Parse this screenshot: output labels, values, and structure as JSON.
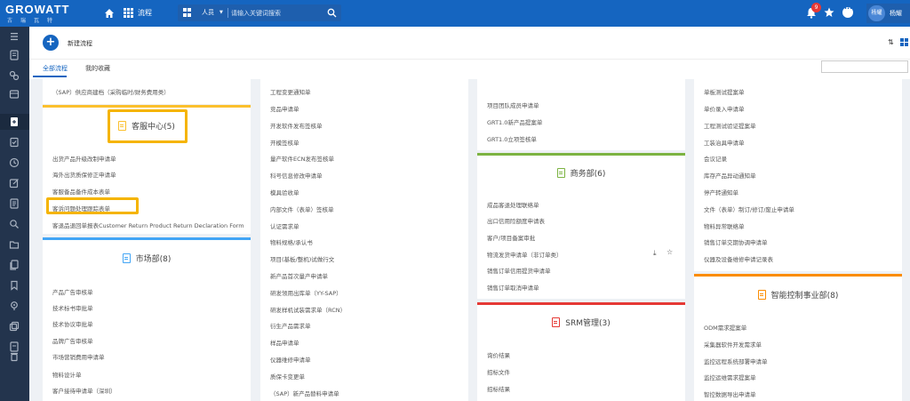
{
  "topbar": {
    "brand": "GROWATT",
    "brand_cn": "古瑞瓦特",
    "nav_label": "流程",
    "search_scope": "人员",
    "search_placeholder": "请输入关键词搜索",
    "notification_count": "9",
    "avatar_text": "杨耀",
    "user_name": "杨耀"
  },
  "header": {
    "title": "新建流程",
    "tabs": [
      "全部流程",
      "我的收藏"
    ]
  },
  "col1": {
    "top_item": "（SAP）供应商建档（采购临时/财务费用类）",
    "cards": [
      {
        "title": "客服中心(5)",
        "items": [
          "出货产品升级改制申请单",
          "海外出货质保修正申请单",
          "客服备品备件成本表单",
          "客诉问题处理跟踪表单",
          "客退品退回单报表Customer Return Product Return Declaration Form"
        ]
      },
      {
        "title": "市场部(8)",
        "items": [
          "产品广告审核单",
          "技术标书审批单",
          "技术协议审批单",
          "品牌广告审核单",
          "市场营销费用申请单",
          "物料设计单",
          "客户接待申请单（深圳）"
        ]
      }
    ]
  },
  "col2": {
    "items": [
      "工程变更通知单",
      "竞品申请单",
      "开发软件发布签核单",
      "开模签核单",
      "量产软件ECN发布签核单",
      "科号信息修改申请单",
      "模具验收单",
      "内部文件（表单）签核单",
      "认证需求单",
      "物料规格/承认书",
      "项目(基板/整机)试做行文",
      "新产品首次量产申请单",
      "研发领用出库单（YY-SAP）",
      "研发样机试装需求单（RCN）",
      "衍生产品需求单",
      "样品申请单",
      "仪器维修申请单",
      "质保卡变更单",
      "（SAP）新产品替料申请单"
    ]
  },
  "col3": {
    "top_items": [
      "项目团队成员申请单",
      "GRT1.0新产品提案单",
      "GRT1.0立项签核单"
    ],
    "cards": [
      {
        "title": "商务部(6)",
        "items": [
          "成品客退处理联络单",
          "出口信用险额度申请表",
          "客户/项目备案审批",
          "物流发货申请单（非订单类）",
          "销售订单信用提货申请单",
          "销售订单取消申请单"
        ]
      },
      {
        "title": "SRM管理(3)",
        "items": [
          "询价结果",
          "招标文件",
          "招标结果"
        ]
      }
    ]
  },
  "col4": {
    "top_items": [
      "单板测试提案单",
      "单价录入申请单",
      "工程测试验证提案单",
      "工装治具申请单",
      "会议记录",
      "库存产品异动通知单",
      "停产转通知单",
      "文件（表单）制订/修订/废止申请单",
      "物料异常联络单",
      "销售订单交期协调申请单",
      "仪器及设备维修申请记录表"
    ],
    "cards": [
      {
        "title": "智能控制事业部(8)",
        "items": [
          "ODM需求提案单",
          "采集器软件开发需求单",
          "监控远程系统部署申请单",
          "监控运维需求提案单",
          "智控数据导出申请单"
        ]
      }
    ]
  }
}
